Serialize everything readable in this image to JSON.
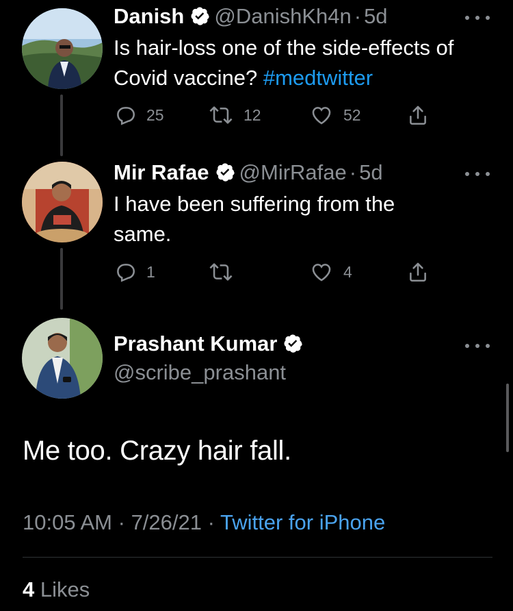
{
  "thread": [
    {
      "name": "Danish",
      "handle": "@DanishKh4n",
      "age": "5d",
      "text_plain": "Is hair-loss one of the side-effects of Covid vaccine?",
      "hashtag": "#medtwitter",
      "replies": "25",
      "retweets": "12",
      "likes": "52"
    },
    {
      "name": "Mir Rafae",
      "handle": "@MirRafae",
      "age": "5d",
      "text_line1": "I have been suffering from the",
      "text_line2": "same.",
      "replies": "1",
      "retweets": "",
      "likes": "4"
    }
  ],
  "main_tweet": {
    "name": "Prashant Kumar",
    "handle": "@scribe_prashant",
    "text": "Me too. Crazy hair fall.",
    "time": "10:05 AM",
    "date": "7/26/21",
    "source": "Twitter for iPhone",
    "likes_count": "4",
    "likes_label": "Likes"
  },
  "separator": "·",
  "icons": {
    "reply": "reply-icon",
    "retweet": "retweet-icon",
    "like": "heart-icon",
    "share": "share-icon",
    "more": "more-options-icon",
    "verified": "verified-badge-icon"
  },
  "colors": {
    "background": "#000000",
    "secondary_text": "#8b8f94",
    "link": "#1d9bf0",
    "thread_line": "#3a3a3c"
  }
}
